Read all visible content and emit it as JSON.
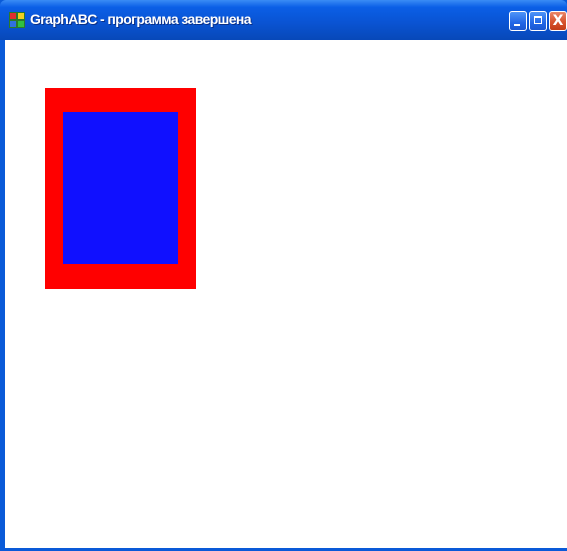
{
  "window": {
    "title": "GraphABC - программа завершена",
    "app_icon": "graphabc-app-icon",
    "buttons": {
      "minimize_icon": "minimize-icon",
      "maximize_icon": "maximize-icon",
      "close_icon": "close-icon",
      "close_glyph": "X"
    }
  },
  "canvas": {
    "background": "#ffffff",
    "shapes": [
      {
        "name": "outer-rectangle",
        "fill": "#ff0000"
      },
      {
        "name": "inner-rectangle",
        "fill": "#1010ff"
      }
    ]
  },
  "colors": {
    "titlebar": "#0a54d4",
    "close_button": "#d8532e"
  }
}
